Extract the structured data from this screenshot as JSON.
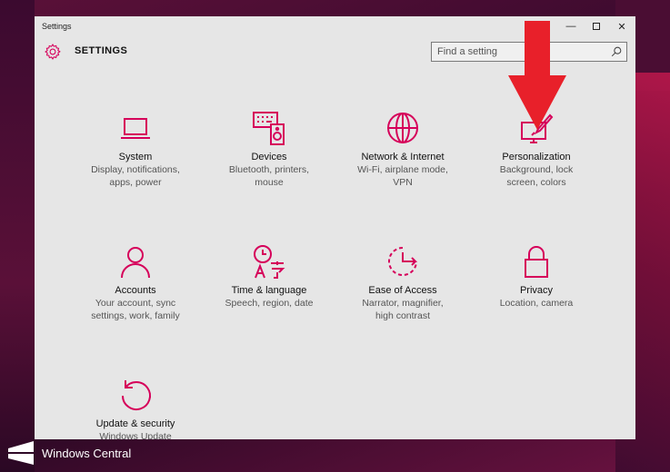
{
  "window": {
    "title": "Settings",
    "minimize_glyph": "—",
    "close_glyph": "✕"
  },
  "header": {
    "title": "SETTINGS",
    "gear_icon": "gear-icon"
  },
  "search": {
    "placeholder": "Find a setting",
    "icon": "search-icon"
  },
  "accent_color": "#d6005a",
  "categories": [
    {
      "title": "System",
      "subtitle_1": "Display, notifications,",
      "subtitle_2": "apps, power",
      "icon": "laptop-icon"
    },
    {
      "title": "Devices",
      "subtitle_1": "Bluetooth, printers,",
      "subtitle_2": "mouse",
      "icon": "keyboard-speaker-icon"
    },
    {
      "title": "Network & Internet",
      "subtitle_1": "Wi-Fi, airplane mode,",
      "subtitle_2": "VPN",
      "icon": "globe-icon"
    },
    {
      "title": "Personalization",
      "subtitle_1": "Background, lock",
      "subtitle_2": "screen, colors",
      "icon": "paintbrush-icon"
    },
    {
      "title": "Accounts",
      "subtitle_1": "Your account, sync",
      "subtitle_2": "settings, work, family",
      "icon": "person-icon"
    },
    {
      "title": "Time & language",
      "subtitle_1": "Speech, region, date",
      "subtitle_2": "",
      "icon": "clock-language-icon"
    },
    {
      "title": "Ease of Access",
      "subtitle_1": "Narrator, magnifier,",
      "subtitle_2": "high contrast",
      "icon": "ease-of-access-icon"
    },
    {
      "title": "Privacy",
      "subtitle_1": "Location, camera",
      "subtitle_2": "",
      "icon": "lock-icon"
    },
    {
      "title": "Update & security",
      "subtitle_1": "Windows Update",
      "subtitle_2": "",
      "icon": "refresh-icon"
    }
  ],
  "annotation": {
    "arrow_color": "#e8202a"
  },
  "watermark": {
    "text": "Windows Central"
  }
}
